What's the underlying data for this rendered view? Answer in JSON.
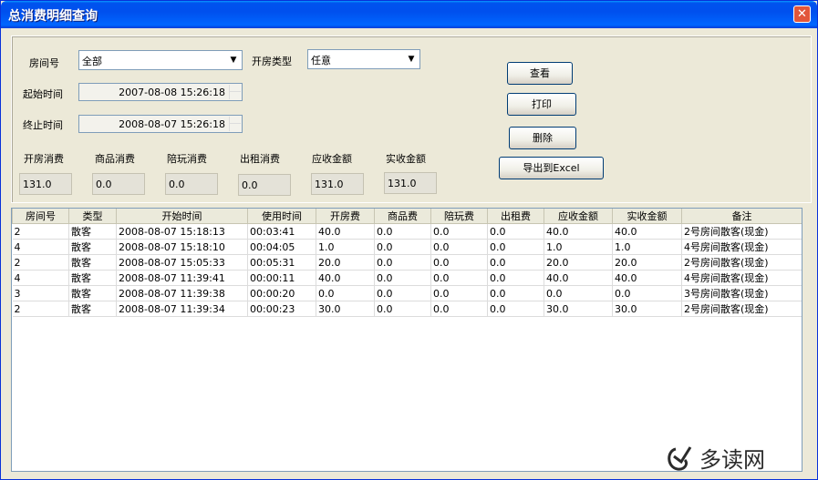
{
  "window": {
    "title": "总消费明细查询",
    "close": "✕"
  },
  "filters": {
    "room_label": "房间号",
    "room_value": "全部",
    "type_label": "开房类型",
    "type_value": "任意",
    "start_label": "起始时间",
    "start_value": "2007-08-08 15:26:18",
    "end_label": "终止时间",
    "end_value": "2008-08-07 15:26:18"
  },
  "summary": [
    {
      "label": "开房消费",
      "value": "131.0"
    },
    {
      "label": "商品消费",
      "value": "0.0"
    },
    {
      "label": "陪玩消费",
      "value": "0.0"
    },
    {
      "label": "出租消费",
      "value": "0.0"
    },
    {
      "label": "应收金额",
      "value": "131.0"
    },
    {
      "label": "实收金额",
      "value": "131.0"
    }
  ],
  "buttons": {
    "view": "查看",
    "print": "打印",
    "delete": "删除",
    "export": "导出到Excel"
  },
  "table": {
    "columns": [
      "房间号",
      "类型",
      "开始时间",
      "使用时间",
      "开房费",
      "商品费",
      "陪玩费",
      "出租费",
      "应收金额",
      "实收金额",
      "备注"
    ],
    "rows": [
      [
        "2",
        "散客",
        "2008-08-07 15:18:13",
        "00:03:41",
        "40.0",
        "0.0",
        "0.0",
        "0.0",
        "40.0",
        "40.0",
        "2号房间散客(现金)"
      ],
      [
        "4",
        "散客",
        "2008-08-07 15:18:10",
        "00:04:05",
        "1.0",
        "0.0",
        "0.0",
        "0.0",
        "1.0",
        "1.0",
        "4号房间散客(现金)"
      ],
      [
        "2",
        "散客",
        "2008-08-07 15:05:33",
        "00:05:31",
        "20.0",
        "0.0",
        "0.0",
        "0.0",
        "20.0",
        "20.0",
        "2号房间散客(现金)"
      ],
      [
        "4",
        "散客",
        "2008-08-07 11:39:41",
        "00:00:11",
        "40.0",
        "0.0",
        "0.0",
        "0.0",
        "40.0",
        "40.0",
        "4号房间散客(现金)"
      ],
      [
        "3",
        "散客",
        "2008-08-07 11:39:38",
        "00:00:20",
        "0.0",
        "0.0",
        "0.0",
        "0.0",
        "0.0",
        "0.0",
        "3号房间散客(现金)"
      ],
      [
        "2",
        "散客",
        "2008-08-07 11:39:34",
        "00:00:23",
        "30.0",
        "0.0",
        "0.0",
        "0.0",
        "30.0",
        "30.0",
        "2号房间散客(现金)"
      ]
    ]
  },
  "watermark": {
    "text": "多读网"
  }
}
